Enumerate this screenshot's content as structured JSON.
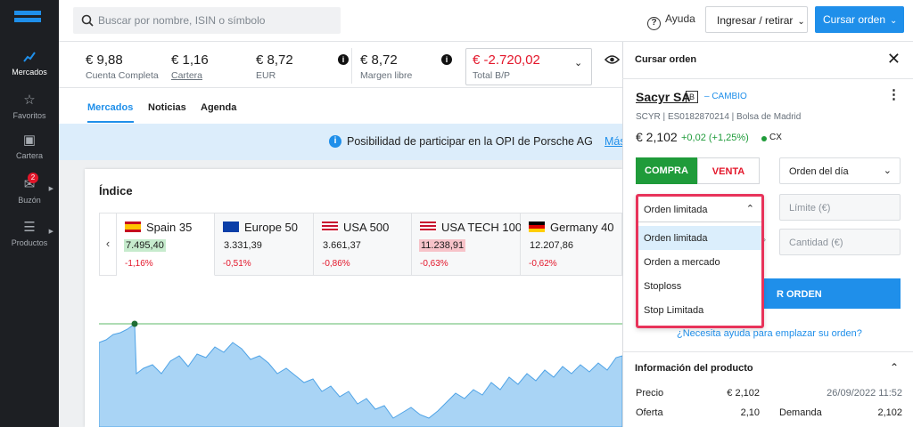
{
  "sidebar": {
    "items": [
      {
        "label": "Mercados",
        "icon": "chart-line-icon"
      },
      {
        "label": "Favoritos",
        "icon": "star-icon"
      },
      {
        "label": "Cartera",
        "icon": "wallet-icon"
      },
      {
        "label": "Buzón",
        "icon": "mail-icon",
        "badge": "2"
      },
      {
        "label": "Productos",
        "icon": "search-list-icon"
      }
    ]
  },
  "header": {
    "search_placeholder": "Buscar por nombre, ISIN o símbolo",
    "help": "Ayuda",
    "deposit": "Ingresar / retirar",
    "order": "Cursar orden"
  },
  "balances": [
    {
      "value": "€ 9,88",
      "label": "Cuenta Completa"
    },
    {
      "value": "€ 1,16",
      "label": "Cartera"
    },
    {
      "value": "€ 8,72",
      "label": "EUR"
    },
    {
      "value": "€ 8,72",
      "label": "Margen libre"
    },
    {
      "value": "€ -2.720,02",
      "label": "Total B/P"
    }
  ],
  "tabs": [
    "Mercados",
    "Noticias",
    "Agenda"
  ],
  "banner": {
    "text": "Posibilidad de participar en la OPI de Porsche AG",
    "link": "Más"
  },
  "index_section": {
    "title": "Índice",
    "cards": [
      {
        "name": "Spain 35",
        "value": "7.495,40",
        "change": "-1,16%"
      },
      {
        "name": "Europe 50",
        "value": "3.331,39",
        "change": "-0,51%"
      },
      {
        "name": "USA 500",
        "value": "3.661,37",
        "change": "-0,86%"
      },
      {
        "name": "USA TECH 100",
        "value": "11.238,91",
        "change": "-0,63%"
      },
      {
        "name": "Germany 40",
        "value": "12.207,86",
        "change": "-0,62%"
      }
    ]
  },
  "order_panel": {
    "title": "Cursar orden",
    "stock_name": "Sacyr SA",
    "stock_tag": "B",
    "exchange_label": "– CAMBIO",
    "stock_info": "SCYR | ES0182870214 | Bolsa de Madrid",
    "price": "€ 2,102",
    "price_change": "+0,02 (+1,25%)",
    "market_status": "CX",
    "buy": "COMPRA",
    "sell": "VENTA",
    "validity": "Orden del día",
    "order_type": "Orden limitada",
    "limit_placeholder": "Límite (€)",
    "quantity_placeholder": "Cantidad (€)",
    "submit_partial": "R ORDEN",
    "help_link": "¿Necesita ayuda para emplazar su orden?",
    "options": [
      "Orden limitada",
      "Orden a mercado",
      "Stoploss",
      "Stop Limitada"
    ]
  },
  "product_info": {
    "title": "Información del producto",
    "rows": [
      {
        "label": "Precio",
        "value": "€ 2,102",
        "extra": "26/09/2022 11:52"
      },
      {
        "label": "Oferta",
        "value": "2,10",
        "extra_label": "Demanda",
        "extra": "2,102"
      }
    ]
  },
  "colors": {
    "accent": "#1f8fea",
    "negative": "#e3162a",
    "positive": "#1f9b3a",
    "highlight": "#e8335a"
  }
}
